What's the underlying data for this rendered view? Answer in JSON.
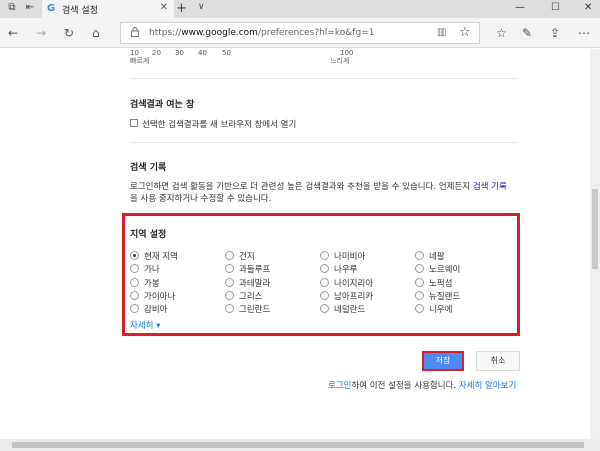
{
  "browser": {
    "tab_title": "검색 설정",
    "tab_favicon": "G",
    "close_tab": "✕",
    "new_tab": "+",
    "tab_menu": "∨",
    "url_prefix": "https://",
    "url_host": "www.google.com",
    "url_path": "/preferences?hl=ko&fg=1",
    "icons": [
      "back-icon",
      "forward-icon",
      "refresh-icon",
      "home-icon",
      "reading-view-icon",
      "favorite-star-icon",
      "favorites-hub-icon",
      "notes-icon",
      "share-icon",
      "more-icon"
    ]
  },
  "results_scale": {
    "ticks": [
      "10",
      "20",
      "30",
      "40",
      "50",
      "100"
    ],
    "left_label": "빠르게",
    "right_label": "느리게"
  },
  "results_window": {
    "heading": "검색결과 여는 창",
    "checkbox_label": "선택한 검색결과를 새 브라우저 창에서 열기",
    "checked": false
  },
  "history": {
    "heading": "검색 기록",
    "text_line1": "로그인하면 검색 활동을 기반으로 더 관련성 높은 검색결과와 추천을 받을 수 있습니다. 언제든지 ",
    "link": "검색 기록",
    "text_line2": "을 사용 중지하거나 수정할 수 있습니다."
  },
  "region": {
    "heading": "지역 설정",
    "selected": "현재 지역",
    "columns": [
      [
        "현재 지역",
        "가나",
        "가봉",
        "가이아나",
        "감비아"
      ],
      [
        "건지",
        "과들루프",
        "과테말라",
        "그리스",
        "그린란드"
      ],
      [
        "나미비아",
        "나우루",
        "나이지리아",
        "남아프리카",
        "네덜란드"
      ],
      [
        "네팔",
        "노르웨이",
        "노퍽섬",
        "뉴질랜드",
        "니우에"
      ]
    ],
    "more_link": "자세히 ▾"
  },
  "actions": {
    "save": "저장",
    "cancel": "취소"
  },
  "footer": {
    "login_link": "로그인",
    "text": "하여 이전 설정을 사용합니다. ",
    "learn_more": "자세히 알아보기"
  },
  "colors": {
    "highlight": "#d7202a",
    "primary_button": "#4c8bf5",
    "link": "#1a0dab"
  }
}
